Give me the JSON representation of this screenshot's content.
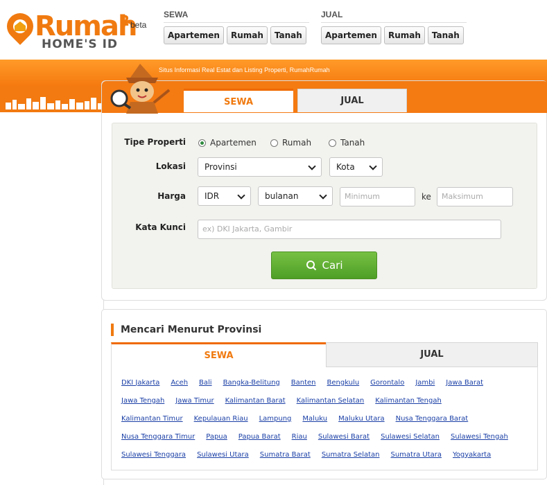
{
  "brand": {
    "name": "Rumah",
    "sup": "2",
    "sub": "HOME'S ID",
    "beta": "beta"
  },
  "nav": {
    "sewa": {
      "label": "SEWA",
      "buttons": [
        "Apartemen",
        "Rumah",
        "Tanah"
      ]
    },
    "jual": {
      "label": "JUAL",
      "buttons": [
        "Apartemen",
        "Rumah",
        "Tanah"
      ]
    }
  },
  "band_text": "Situs Informasi Real Estat dan Listing Properti, RumahRumah",
  "search": {
    "tabs": {
      "sewa": "SEWA",
      "jual": "JUAL"
    },
    "tipe_label": "Tipe Properti",
    "tipe_options": [
      "Apartemen",
      "Rumah",
      "Tanah"
    ],
    "tipe_selected": "Apartemen",
    "lokasi_label": "Lokasi",
    "provinsi": "Provinsi",
    "kota": "Kota",
    "harga_label": "Harga",
    "currency": "IDR",
    "period": "bulanan",
    "min_placeholder": "Minimum",
    "ke": "ke",
    "max_placeholder": "Maksimum",
    "keyword_label": "Kata Kunci",
    "keyword_placeholder": "ex) DKI Jakarta, Gambir",
    "button": "Cari"
  },
  "province": {
    "title": "Mencari Menurut Provinsi",
    "tabs": {
      "sewa": "SEWA",
      "jual": "JUAL"
    },
    "rows": [
      [
        "DKI Jakarta",
        "Aceh",
        "Bali",
        "Bangka-Belitung",
        "Banten",
        "Bengkulu",
        "Gorontalo",
        "Jambi",
        "Jawa Barat"
      ],
      [
        "Jawa Tengah",
        "Jawa Timur",
        "Kalimantan Barat",
        "Kalimantan Selatan",
        "Kalimantan Tengah"
      ],
      [
        "Kalimantan Timur",
        "Kepulauan Riau",
        "Lampung",
        "Maluku",
        "Maluku Utara",
        "Nusa Tenggara Barat"
      ],
      [
        "Nusa Tenggara Timur",
        "Papua",
        "Papua Barat",
        "Riau",
        "Sulawesi Barat",
        "Sulawesi Selatan",
        "Sulawesi Tengah"
      ],
      [
        "Sulawesi Tenggara",
        "Sulawesi Utara",
        "Sumatra Barat",
        "Sumatra Selatan",
        "Sumatra Utara",
        "Yogyakarta"
      ]
    ]
  },
  "colors": {
    "brand_orange": "#f07a10",
    "link": "#1a3fa6",
    "button_green": "#5aa82e"
  }
}
